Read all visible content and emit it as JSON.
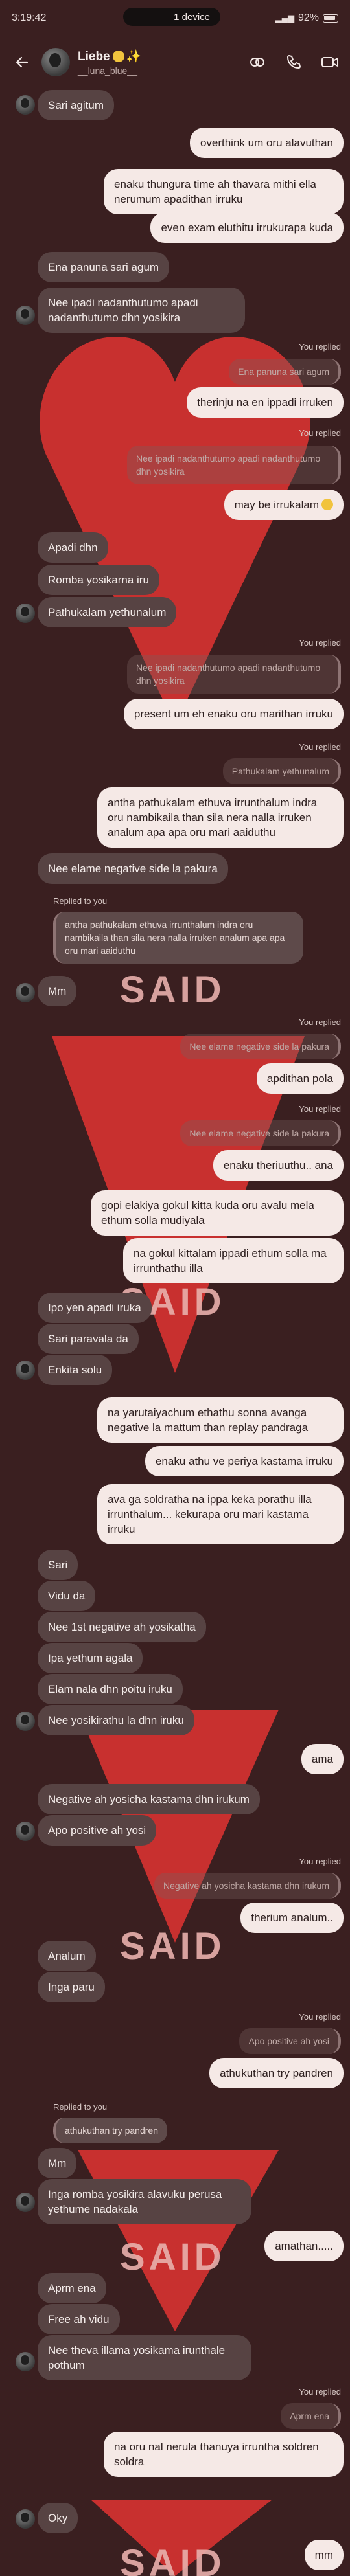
{
  "status_bar": {
    "time": "3:19:42",
    "device_label": "1 device",
    "battery": "92%"
  },
  "header": {
    "contact_name": "Liebe",
    "contact_username": "__luna_blue__"
  },
  "colors": {
    "background": "#3a1f20",
    "heart": "#c8302f",
    "incoming_bubble": "#574343",
    "outgoing_bubble": "#f5e9e6",
    "said_text": "#e9b0ac"
  },
  "background_text": "SAID",
  "messages": {
    "m1": "Sari agitum",
    "m2": "overthink um oru alavuthan",
    "m3": "enaku thungura time ah thavara mithi ella nerumum apadithan irruku",
    "m4": "even exam eluthitu irrukurapa kuda",
    "m5": "Ena panuna sari agum",
    "m6": "Nee ipadi nadanthutumo apadi nadanthutumo dhn yosikira",
    "m7_label": "You replied",
    "m7_quote": "Ena panuna sari agum",
    "m7": "therinju na en ippadi irruken",
    "m8_label": "You replied",
    "m8_quote": "Nee ipadi nadanthutumo apadi nadanthutumo dhn yosikira",
    "m8": "may be irrukalam",
    "m9": "Apadi dhn",
    "m10": "Romba yosikarna iru",
    "m11": "Pathukalam yethunalum",
    "m12_label": "You replied",
    "m12_quote": "Nee ipadi nadanthutumo apadi nadanthutumo dhn yosikira",
    "m12": "present um eh enaku oru marithan irruku",
    "m13_label": "You replied",
    "m13_quote": "Pathukalam yethunalum",
    "m13": "antha pathukalam ethuva irrunthalum indra oru nambikaila than sila nera nalla irruken analum apa apa oru mari aaiduthu",
    "m14": "Nee elame negative side la pakura",
    "m15_label": "Replied to you",
    "m15_quote": "antha pathukalam ethuva irrunthalum indra oru nambikaila than sila nera nalla irruken analum apa apa oru mari aaiduthu",
    "m15": "Mm",
    "m16_label": "You replied",
    "m16_quote": "Nee elame negative side la pakura",
    "m16": "apdithan pola",
    "m17_label": "You replied",
    "m17_quote": "Nee elame negative side la pakura",
    "m17": "enaku theriuuthu.. ana",
    "m18": "gopi elakiya gokul kitta kuda oru avalu mela ethum solla mudiyala",
    "m19": "na gokul kittalam ippadi ethum solla ma irrunthathu illa",
    "m20": "Ipo yen apadi iruka",
    "m21": "Sari paravala da",
    "m22": "Enkita solu",
    "m23": "na yarutaiyachum ethathu sonna avanga negative la mattum than replay pandraga",
    "m24": "enaku athu ve periya kastama irruku",
    "m25": "ava ga soldratha na ippa keka porathu illa irrunthalum... kekurapa oru mari kastama irruku",
    "m26": "Sari",
    "m27": "Vidu da",
    "m28": "Nee 1st negative ah yosikatha",
    "m29": "Ipa yethum agala",
    "m30": "Elam nala dhn poitu iruku",
    "m31": "Nee yosikirathu la dhn iruku",
    "m32": "ama",
    "m33": "Negative ah yosicha kastama dhn irukum",
    "m34": "Apo positive ah yosi",
    "m35_label": "You replied",
    "m35_quote": "Negative ah yosicha kastama dhn irukum",
    "m35": "therium analum..",
    "m36": "Analum",
    "m37": "Inga paru",
    "m38_label": "You replied",
    "m38_quote": "Apo positive ah yosi",
    "m38": "athukuthan try pandren",
    "m39_label": "Replied to you",
    "m39_quote": "athukuthan try pandren",
    "m39": "Mm",
    "m40": "Inga romba yosikira alavuku perusa yethume nadakala",
    "m41": "amathan.....",
    "m42": "Aprm ena",
    "m43": "Free ah vidu",
    "m44": "Nee theva illama yosikama irunthale pothum",
    "m45_label": "You replied",
    "m45_quote": "Aprm ena",
    "m45": "na oru nal nerula thanuya irruntha soldren soldra",
    "m46": "Oky",
    "m47": "mm"
  }
}
